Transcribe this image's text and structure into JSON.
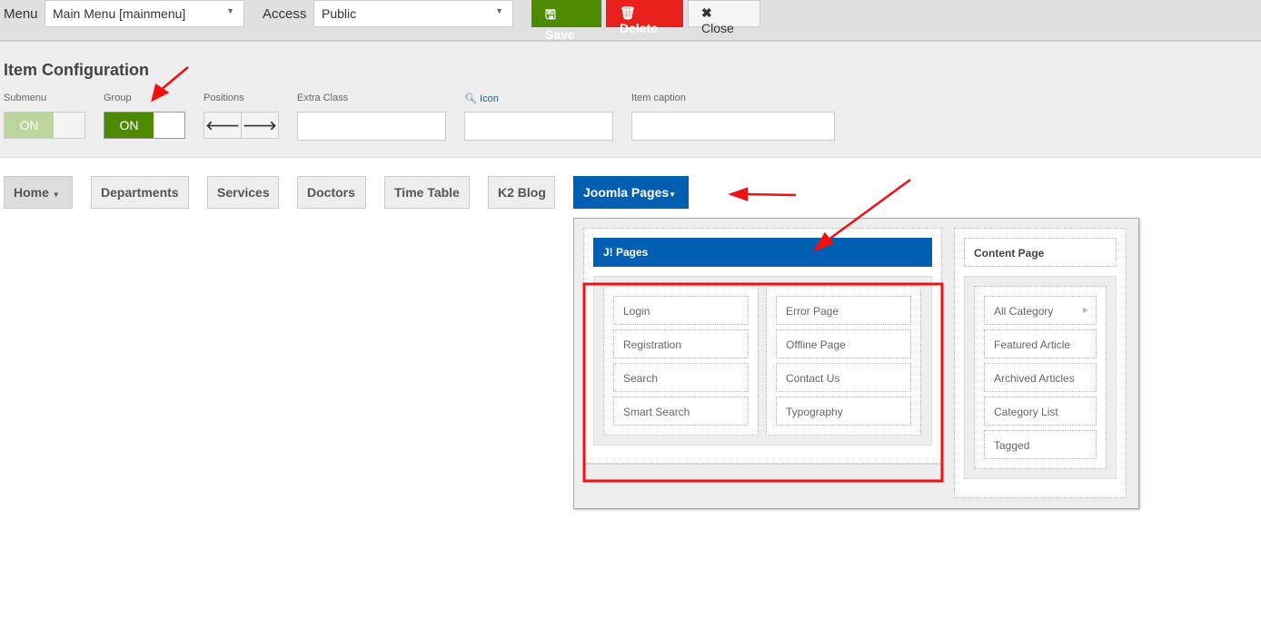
{
  "toolbar": {
    "menu_label": "Menu",
    "menu_value": "Main Menu [mainmenu]",
    "access_label": "Access",
    "access_value": "Public",
    "save": "Save",
    "delete": "Delete",
    "close": "Close"
  },
  "config": {
    "title": "Item Configuration",
    "submenu_label": "Submenu",
    "submenu_state": "ON",
    "group_label": "Group",
    "group_state": "ON",
    "positions_label": "Positions",
    "extra_class_label": "Extra Class",
    "icon_label": "Icon",
    "caption_label": "Item caption"
  },
  "nav": [
    "Home",
    "Departments",
    "Services",
    "Doctors",
    "Time Table",
    "K2 Blog",
    "Joomla Pages"
  ],
  "dropdown": {
    "group_title": "J! Pages",
    "col1": [
      "Login",
      "Registration",
      "Search",
      "Smart Search"
    ],
    "col2": [
      "Error Page",
      "Offline Page",
      "Contact Us",
      "Typography"
    ],
    "content_title": "Content Page",
    "content_items": [
      "All Category",
      "Featured Article",
      "Archived Articles",
      "Category List",
      "Tagged"
    ]
  },
  "colors": {
    "green": "#4e8a00",
    "red": "#e8211d",
    "blue": "#005fb0"
  }
}
